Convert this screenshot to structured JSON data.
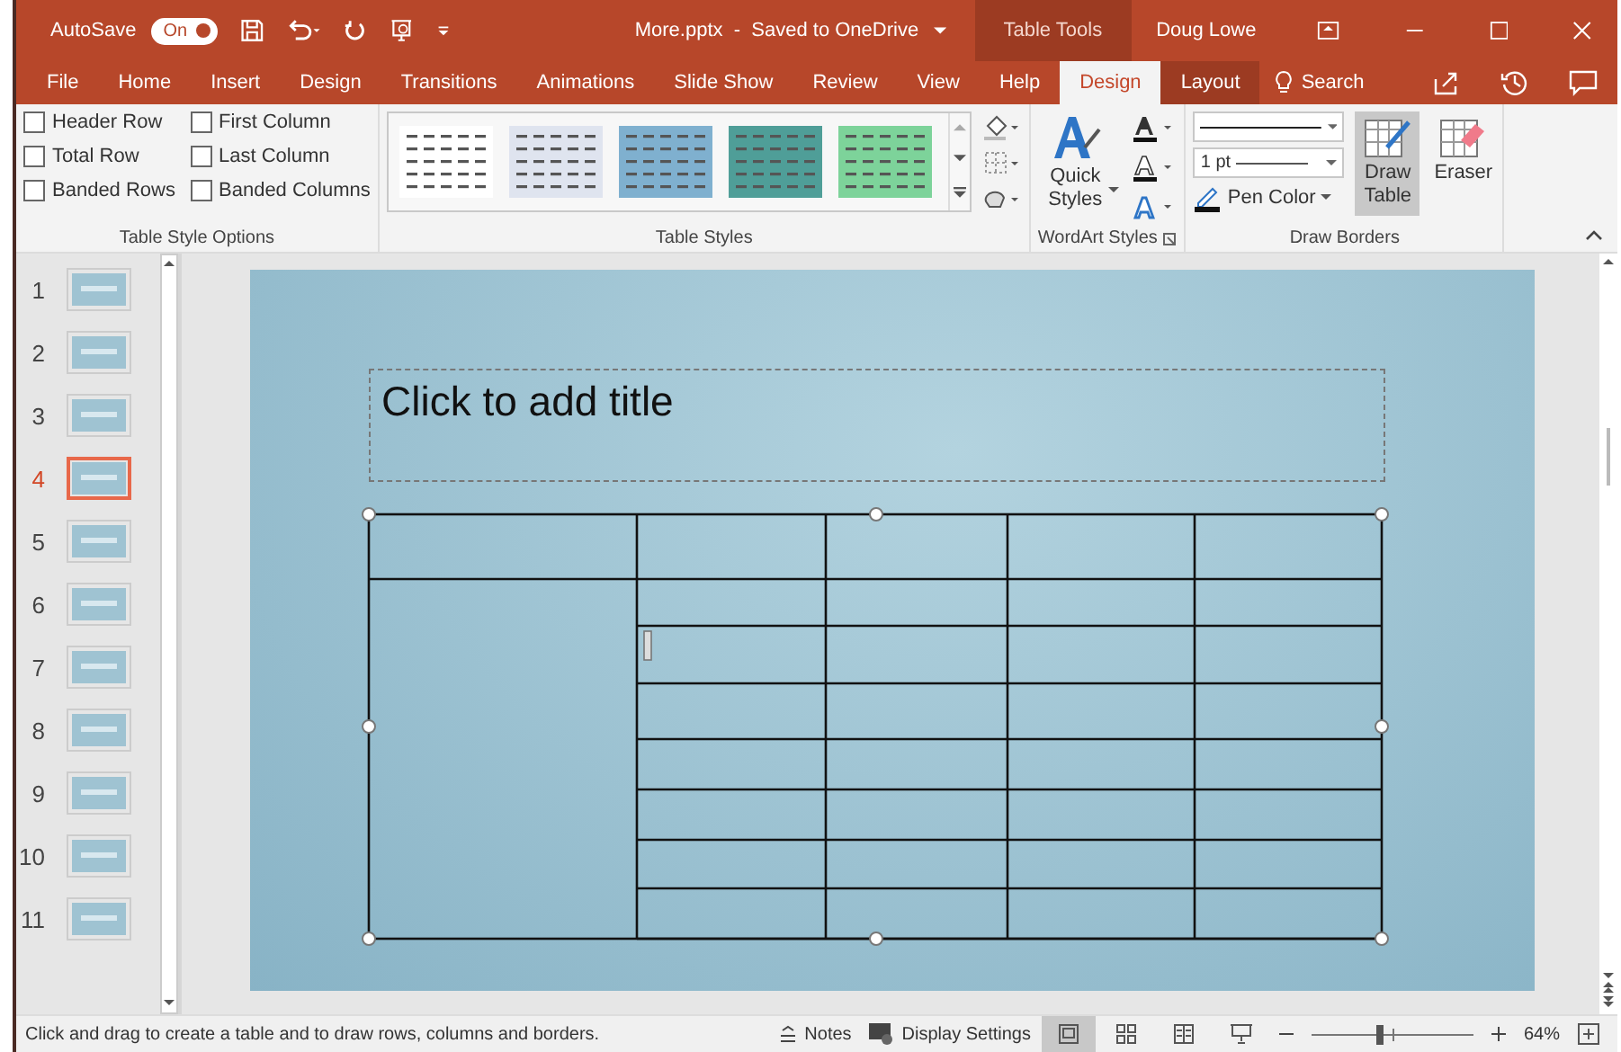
{
  "title_bar": {
    "autosave_label": "AutoSave",
    "autosave": {
      "on": true,
      "label": "On"
    },
    "document_title": "More.pptx  -  Saved to OneDrive",
    "context_label": "Table Tools",
    "user_name": "Doug Lowe"
  },
  "tabs": [
    {
      "label": "File",
      "selected": false,
      "contextual": false
    },
    {
      "label": "Home",
      "selected": false,
      "contextual": false
    },
    {
      "label": "Insert",
      "selected": false,
      "contextual": false
    },
    {
      "label": "Design",
      "selected": false,
      "contextual": false
    },
    {
      "label": "Transitions",
      "selected": false,
      "contextual": false
    },
    {
      "label": "Animations",
      "selected": false,
      "contextual": false
    },
    {
      "label": "Slide Show",
      "selected": false,
      "contextual": false
    },
    {
      "label": "Review",
      "selected": false,
      "contextual": false
    },
    {
      "label": "View",
      "selected": false,
      "contextual": false
    },
    {
      "label": "Help",
      "selected": false,
      "contextual": false
    },
    {
      "label": "Design",
      "selected": true,
      "contextual": true
    },
    {
      "label": "Layout",
      "selected": false,
      "contextual": true
    }
  ],
  "search": {
    "label": "Search"
  },
  "ribbon": {
    "table_style_options": {
      "label": "Table Style Options",
      "options": [
        {
          "label": "Header Row",
          "checked": false
        },
        {
          "label": "First Column",
          "checked": false
        },
        {
          "label": "Total Row",
          "checked": false
        },
        {
          "label": "Last Column",
          "checked": false
        },
        {
          "label": "Banded Rows",
          "checked": false
        },
        {
          "label": "Banded Columns",
          "checked": false
        }
      ]
    },
    "table_styles": {
      "label": "Table Styles",
      "styles": [
        {
          "color": "#ffffff"
        },
        {
          "color": "#dfe4ef"
        },
        {
          "color": "#7fb0cf"
        },
        {
          "color": "#4f9e98"
        },
        {
          "color": "#7dd39a"
        }
      ]
    },
    "wordart_styles": {
      "label": "WordArt Styles",
      "quick_styles": "Quick Styles"
    },
    "draw_borders": {
      "label": "Draw Borders",
      "pen_weight": "1 pt",
      "pen_color": "Pen Color",
      "draw_table": {
        "label": "Draw Table",
        "selected": true
      },
      "eraser": {
        "label": "Eraser",
        "selected": false
      }
    }
  },
  "slides": [
    {
      "number": "1",
      "selected": false
    },
    {
      "number": "2",
      "selected": false
    },
    {
      "number": "3",
      "selected": false
    },
    {
      "number": "4",
      "selected": true
    },
    {
      "number": "5",
      "selected": false
    },
    {
      "number": "6",
      "selected": false
    },
    {
      "number": "7",
      "selected": false
    },
    {
      "number": "8",
      "selected": false
    },
    {
      "number": "9",
      "selected": false
    },
    {
      "number": "10",
      "selected": false
    },
    {
      "number": "11",
      "selected": false
    }
  ],
  "slide": {
    "title_placeholder": "Click to add title"
  },
  "status_bar": {
    "message": "Click and drag to create a table and to draw rows, columns and borders.",
    "notes": "Notes",
    "display_settings": "Display Settings",
    "views": [
      {
        "kind": "normal",
        "selected": true
      },
      {
        "kind": "sorter",
        "selected": false
      },
      {
        "kind": "reading",
        "selected": false
      },
      {
        "kind": "show",
        "selected": false
      }
    ],
    "zoom": {
      "level": 0.42,
      "reading": "64%"
    }
  }
}
